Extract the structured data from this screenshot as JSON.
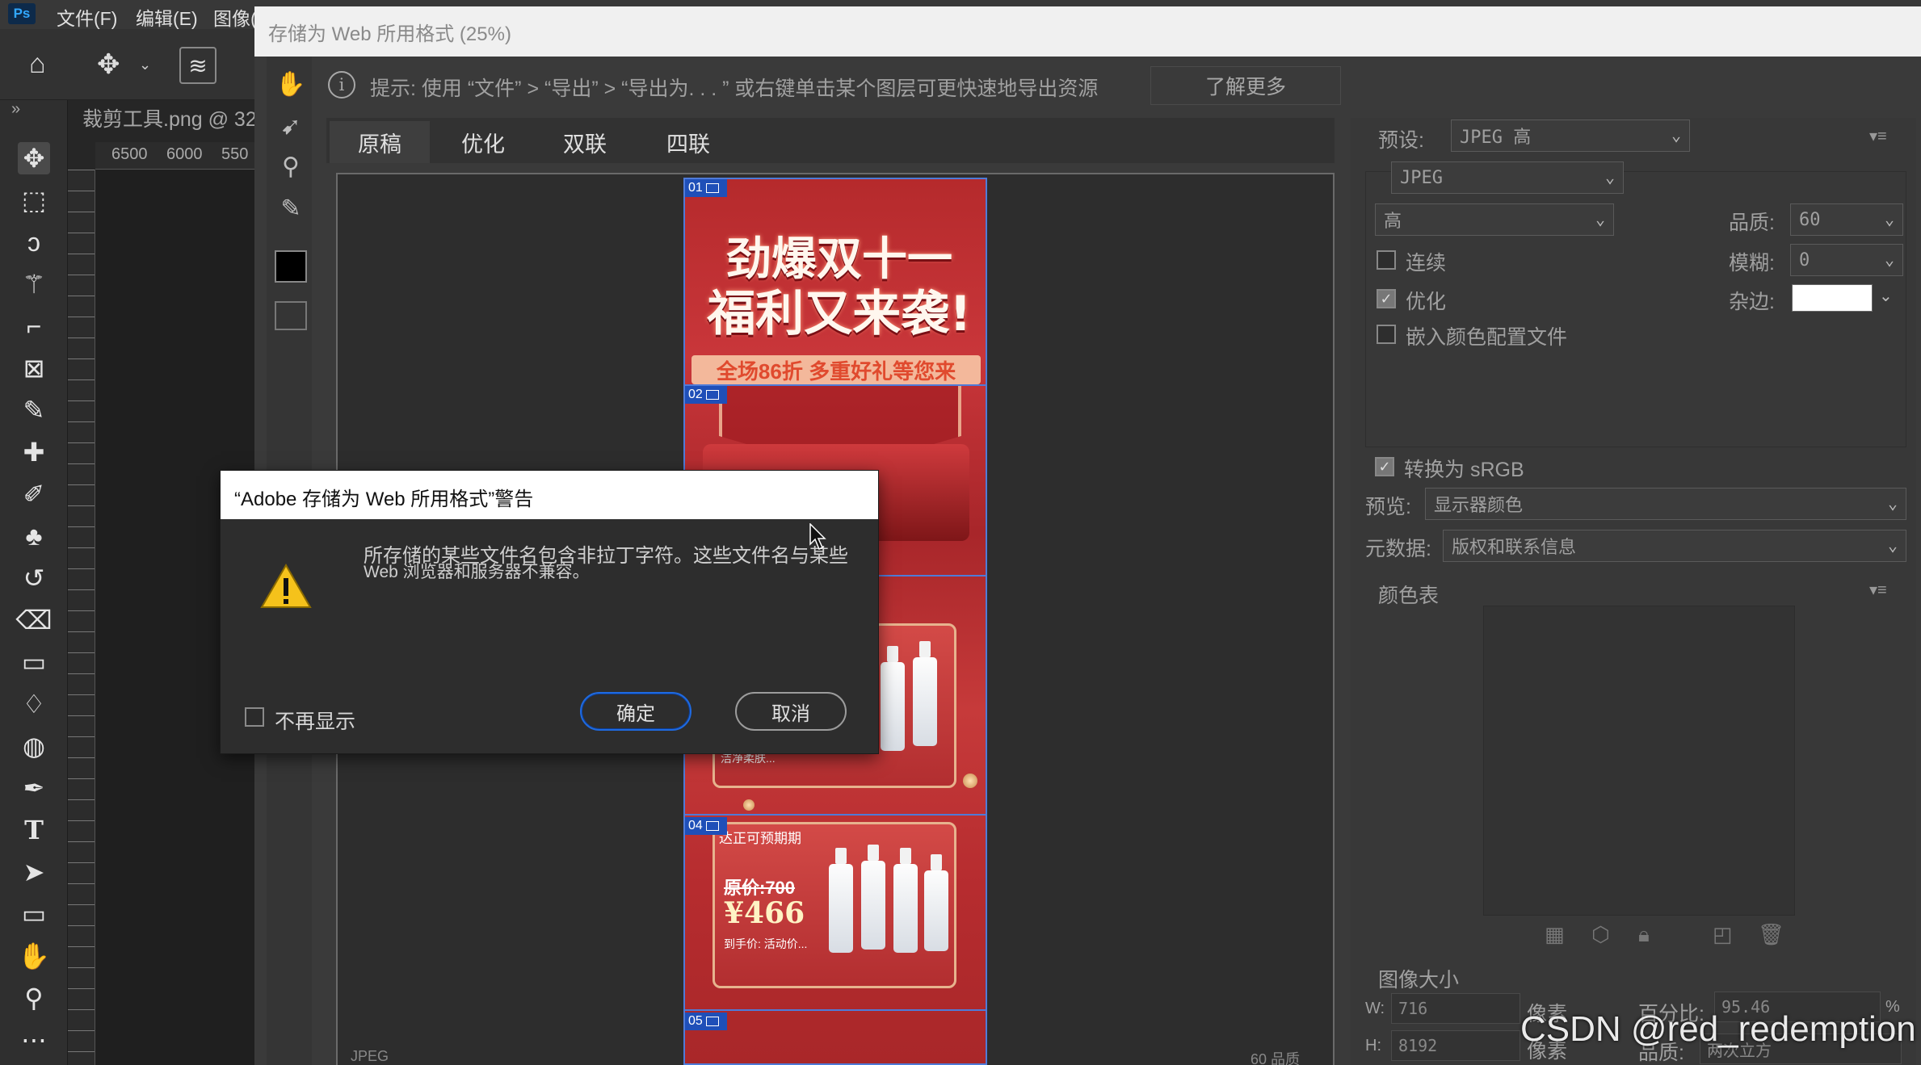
{
  "photoshop": {
    "logo": "Ps",
    "menu": [
      "文件(F)",
      "编辑(E)",
      "图像("
    ],
    "document_tab": "裁剪工具.png @ 32.",
    "ruler_labels": [
      "6500",
      "6000",
      "550"
    ],
    "toolbar_icons": [
      "move-icon",
      "marquee-icon",
      "lasso-icon",
      "magic-wand-icon",
      "crop-icon",
      "frame-icon",
      "eyedropper-icon",
      "healing-icon",
      "brush-icon",
      "clone-stamp-icon",
      "history-brush-icon",
      "eraser-icon",
      "gradient-icon",
      "blur-icon",
      "dodge-icon",
      "pen-icon",
      "type-icon",
      "path-select-icon",
      "rectangle-icon",
      "hand-icon",
      "zoom-icon",
      "more-icon"
    ]
  },
  "save_for_web": {
    "title": "存储为 Web 所用格式 (25%)",
    "hint_prefix": "提示:",
    "hint_text": "使用 “文件” > “导出” > “导出为. . . ” 或右键单击某个图层可更快速地导出资源",
    "learn_more": "了解更多",
    "tabs": [
      "原稿",
      "优化",
      "双联",
      "四联"
    ],
    "active_tab": "原稿",
    "preview_footer_left": "JPEG",
    "preview_footer_right": "60 品质",
    "slices": [
      "01",
      "02",
      "04",
      "05"
    ],
    "image_text": {
      "headline1": "劲爆双十一",
      "headline2": "福利又来袭!",
      "promo": "全场86折 多重好礼等您来",
      "card4_title": "达正可预期期",
      "old_price": "原价:700",
      "new_price": "¥466",
      "card4_desc": "到手价:\n活动价...",
      "card3_desc": "洁净柔肤..."
    },
    "settings": {
      "preset_label": "预设:",
      "preset_value": "JPEG 高",
      "format_value": "JPEG",
      "compression_value": "高",
      "quality_label": "品质:",
      "quality_value": "60",
      "blur_label": "模糊:",
      "blur_value": "0",
      "matte_label": "杂边:",
      "matte_color": "#ffffff",
      "progressive_label": "连续",
      "progressive_checked": false,
      "optimized_label": "优化",
      "optimized_checked": true,
      "embed_profile_label": "嵌入颜色配置文件",
      "embed_profile_checked": false,
      "convert_srgb_label": "转换为 sRGB",
      "convert_srgb_checked": true,
      "preview_label": "预览:",
      "preview_value": "显示器颜色",
      "metadata_label": "元数据:",
      "metadata_value": "版权和联系信息",
      "color_table_label": "颜色表",
      "image_size_label": "图像大小",
      "width_label": "W:",
      "width_value": "716",
      "height_label": "H:",
      "height_value": "8192",
      "unit_pixels": "像素",
      "percent_label": "百分比:",
      "percent_value": "95.46",
      "percent_unit": "%",
      "quality2_label": "品质:",
      "quality2_value": "两次立方"
    }
  },
  "warning_dialog": {
    "title": "“Adobe 存储为 Web 所用格式”警告",
    "message_line1": "所存储的某些文件名包含非拉丁字符。这些文件名与某些",
    "message_line2": "Web 浏览器和服务器不兼容。",
    "dont_show_label": "不再显示",
    "dont_show_checked": false,
    "ok_label": "确定",
    "cancel_label": "取消"
  },
  "watermark": "CSDN @red_redemption"
}
